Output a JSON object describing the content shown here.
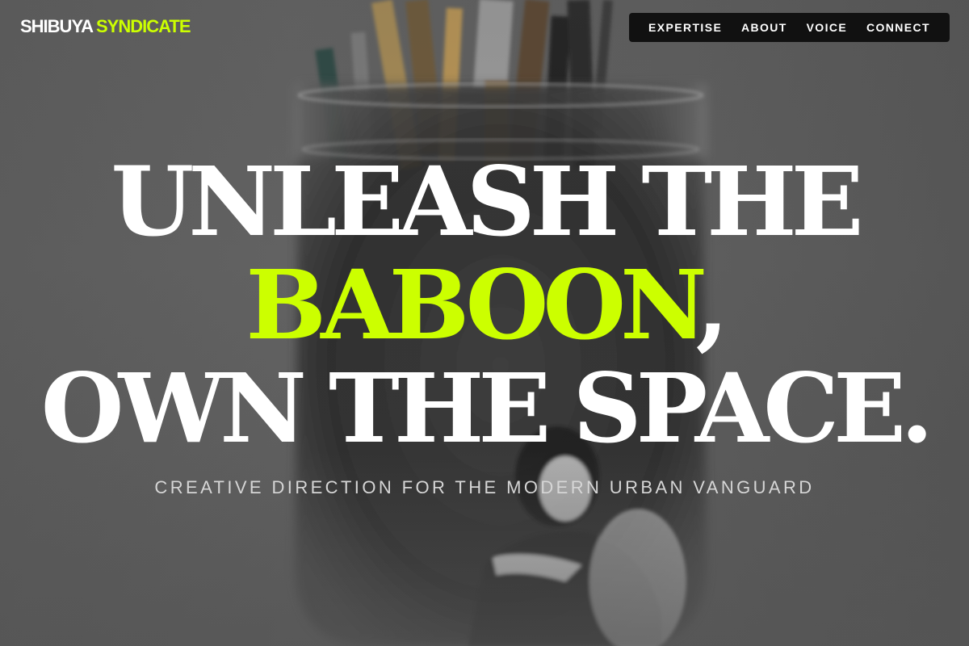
{
  "header": {
    "logo_primary": "SHIBUYA",
    "logo_accent": "SYNDICATE"
  },
  "nav": {
    "items": [
      {
        "label": "EXPERTISE"
      },
      {
        "label": "ABOUT"
      },
      {
        "label": "VOICE"
      },
      {
        "label": "CONNECT"
      }
    ]
  },
  "hero": {
    "line1": "UNLEASH THE",
    "line2_accent": "BABOON",
    "line2_suffix": ",",
    "line3": "OWN THE SPACE.",
    "tagline": "CREATIVE DIRECTION FOR THE MODERN URBAN VANGUARD"
  },
  "colors": {
    "accent": "#ccff00",
    "nav_background": "#111111",
    "background": "#5c5c5c"
  }
}
